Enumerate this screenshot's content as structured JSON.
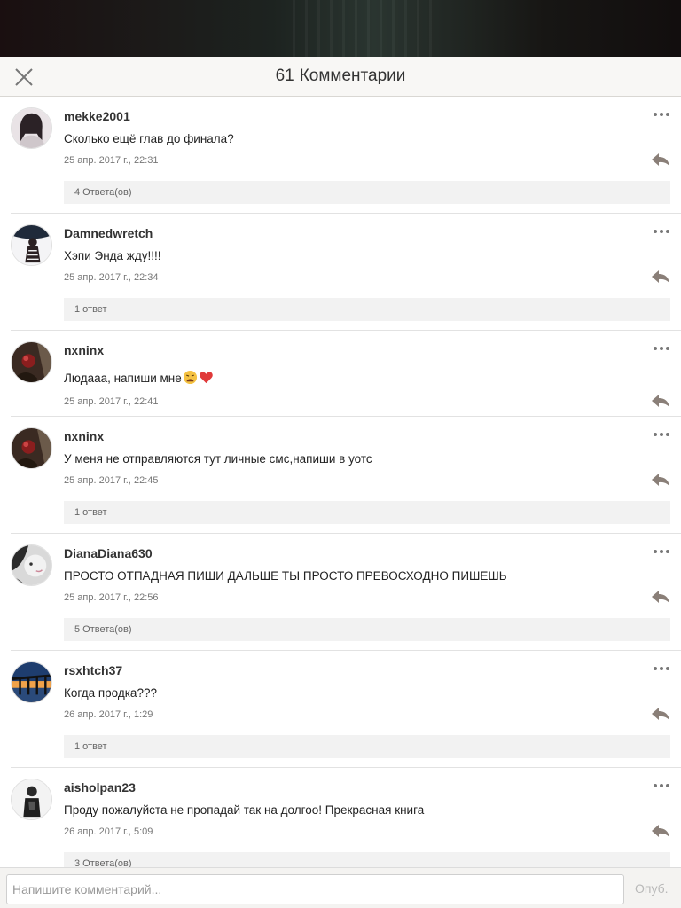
{
  "header": {
    "count": "61",
    "title": "Комментарии"
  },
  "comments": [
    {
      "username": "mekke2001",
      "text": "Сколько ещё глав до финала?",
      "date": "25 апр. 2017 г., 22:31",
      "replies": "4 Ответа(ов)",
      "avatar": "avatar-girl-icon"
    },
    {
      "username": "Damnedwretch",
      "text": "Хэпи Энда жду!!!!",
      "date": "25 апр. 2017 г., 22:34",
      "replies": "1 ответ",
      "avatar": "avatar-figure-icon"
    },
    {
      "username": "nxninx_",
      "text": "Людааа, напиши мне",
      "date": "25 апр. 2017 г., 22:41",
      "replies": "",
      "avatar": "avatar-dark-red-icon"
    },
    {
      "username": "nxninx_",
      "text": "У меня не отправляются тут личные смс,напиши в уотс",
      "date": "25 апр. 2017 г., 22:45",
      "replies": "1 ответ",
      "avatar": "avatar-dark-red-icon"
    },
    {
      "username": "DianaDiana630",
      "text": "ПРОСТО ОТПАДНАЯ ПИШИ ДАЛЬШЕ ТЫ ПРОСТО ПРЕВОСХОДНО ПИШЕШЬ",
      "date": "25 апр. 2017 г., 22:56",
      "replies": "5 Ответа(ов)",
      "avatar": "avatar-bw-face-icon"
    },
    {
      "username": "rsxhtch37",
      "text": "Когда продка???",
      "date": "26 апр. 2017 г., 1:29",
      "replies": "1 ответ",
      "avatar": "avatar-sunset-icon"
    },
    {
      "username": "aisholpan23",
      "text": "Проду пожалуйста не пропадай так на долгоо! Прекрасная книга",
      "date": "26 апр. 2017 г., 5:09",
      "replies": "3 Ответа(ов)",
      "avatar": "avatar-person-icon"
    }
  ],
  "footer": {
    "placeholder": "Напишите комментарий...",
    "submit_label": "Опуб."
  },
  "colors": {
    "header_bg": "#f8f7f5",
    "reply_icon": "#8a7f78",
    "replies_bg": "#f2f2f2"
  }
}
